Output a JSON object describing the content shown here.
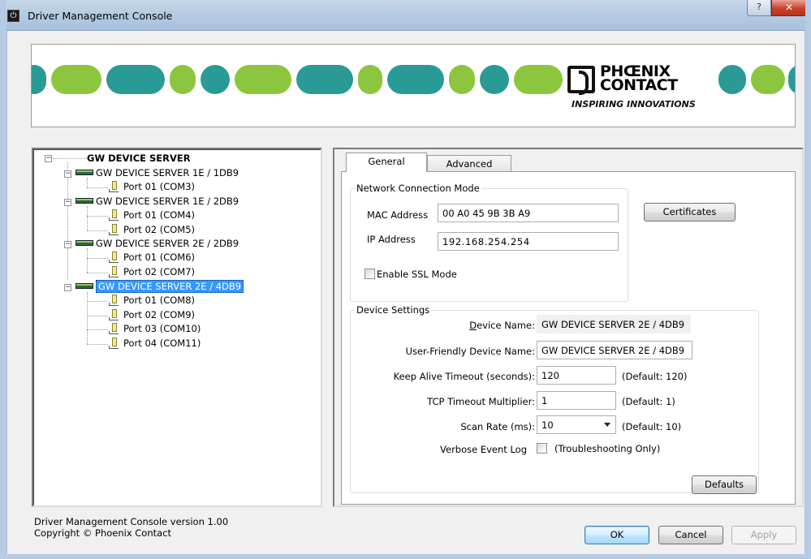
{
  "window": {
    "title": "Driver Management Console",
    "help_label": "?",
    "close_label": "✕"
  },
  "banner": {
    "logo_line1": "PHŒNIX",
    "logo_line2": "CONTACT",
    "tagline": "INSPIRING INNOVATIONS"
  },
  "tree": {
    "root": "GW DEVICE SERVER",
    "devices": [
      {
        "label": "GW DEVICE SERVER 1E / 1DB9",
        "ports": [
          "Port 01 (COM3)"
        ]
      },
      {
        "label": "GW DEVICE SERVER 1E / 2DB9",
        "ports": [
          "Port 01 (COM4)",
          "Port 02 (COM5)"
        ]
      },
      {
        "label": "GW DEVICE SERVER 2E / 2DB9",
        "ports": [
          "Port 01 (COM6)",
          "Port 02 (COM7)"
        ]
      },
      {
        "label": "GW DEVICE SERVER 2E / 4DB9",
        "ports": [
          "Port 01 (COM8)",
          "Port 02 (COM9)",
          "Port 03 (COM10)",
          "Port 04 (COM11)"
        ]
      }
    ],
    "selected_device": "GW DEVICE SERVER 2E / 4DB9"
  },
  "tabs": {
    "general": "General",
    "advanced": "Advanced"
  },
  "network": {
    "legend": "Network Connection Mode",
    "mac_label": "MAC Address",
    "mac_value": "00 A0 45 9B 3B A9",
    "ip_label": "IP Address",
    "ip_value": "192.168.254.254",
    "ssl_label": "Enable SSL Mode",
    "certificates_button": "Certificates"
  },
  "device": {
    "legend": "Device Settings",
    "name_label": "Device Name:",
    "name_value": "GW DEVICE SERVER 2E / 4DB9",
    "friendly_label": "User-Friendly Device Name:",
    "friendly_value": "GW DEVICE SERVER 2E / 4DB9",
    "keepalive_label": "Keep Alive Timeout (seconds):",
    "keepalive_value": "120",
    "keepalive_default": "(Default: 120)",
    "tcp_label": "TCP Timeout Multiplier:",
    "tcp_value": "1",
    "tcp_default": "(Default: 1)",
    "scan_label": "Scan Rate (ms):",
    "scan_value": "10",
    "scan_default": "(Default: 10)",
    "verbose_label": "Verbose Event Log",
    "verbose_note": "(Troubleshooting Only)",
    "defaults_button": "Defaults"
  },
  "footer": {
    "version": "Driver Management Console version 1.00",
    "copyright": "Copyright © Phoenix Contact",
    "ok": "OK",
    "cancel": "Cancel",
    "apply": "Apply"
  },
  "colors": {
    "teal": "#2a9a96",
    "lime": "#8cc63e",
    "selection": "#3399ff"
  }
}
